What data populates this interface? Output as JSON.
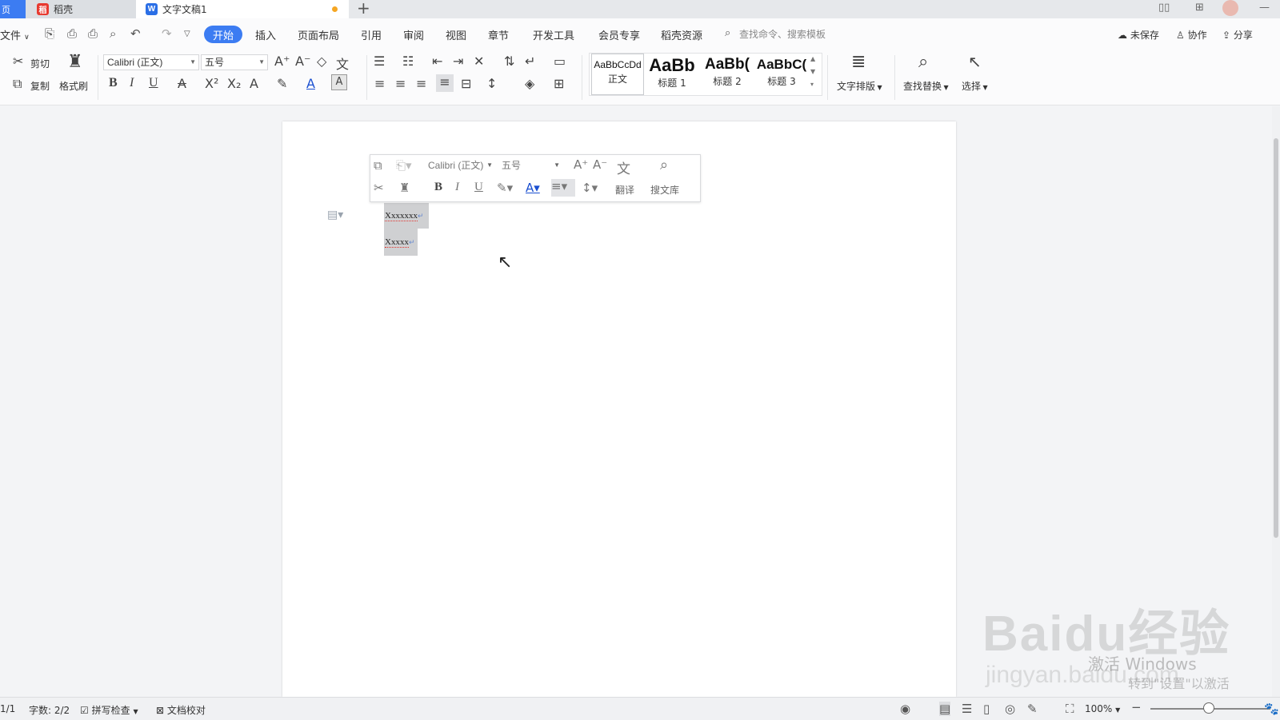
{
  "tabs": {
    "home_icon": "home-icon",
    "tab1_label": "稻壳",
    "tab2_label": "文字文稿1",
    "tab2_unsaved_color": "#f5a623",
    "new_tab": "+"
  },
  "menubar": {
    "file_label": "文件",
    "items": [
      "开始",
      "插入",
      "页面布局",
      "引用",
      "审阅",
      "视图",
      "章节",
      "开发工具",
      "会员专享",
      "稻壳资源"
    ],
    "active_index": 0,
    "search_placeholder": "查找命令、搜索模板",
    "unsaved": "未保存",
    "collab": "协作",
    "share": "分享"
  },
  "ribbon": {
    "cut": "剪切",
    "copy": "复制",
    "format_painter": "格式刷",
    "font_name": "Calibri (正文)",
    "font_size": "五号",
    "styles": [
      {
        "sample": "AaBbCcDd",
        "name": "正文"
      },
      {
        "sample": "AaBb",
        "name": "标题 1"
      },
      {
        "sample": "AaBb(",
        "name": "标题 2"
      },
      {
        "sample": "AaBbC(",
        "name": "标题 3"
      }
    ],
    "text_layout": "文字排版",
    "find_replace": "查找替换",
    "select": "选择"
  },
  "minitoolbar": {
    "font_name": "Calibri (正文)",
    "font_size": "五号",
    "translate": "翻译",
    "search_lib": "搜文库"
  },
  "document": {
    "lines": [
      "Xxxxxxx",
      "Xxxxx"
    ]
  },
  "status": {
    "page": "1/1",
    "word_count": "字数: 2/2",
    "spell_check": "拼写检查",
    "doc_proof": "文档校对",
    "zoom": "100%"
  },
  "watermark": {
    "brand": "Baidu经验",
    "url": "jingyan.baidu.com",
    "activate1": "激活 Windows",
    "activate2": "转到\"设置\"以激活 Windows。"
  },
  "colors": {
    "accent": "#3c7cf2",
    "selection": "#cfd0d2"
  }
}
